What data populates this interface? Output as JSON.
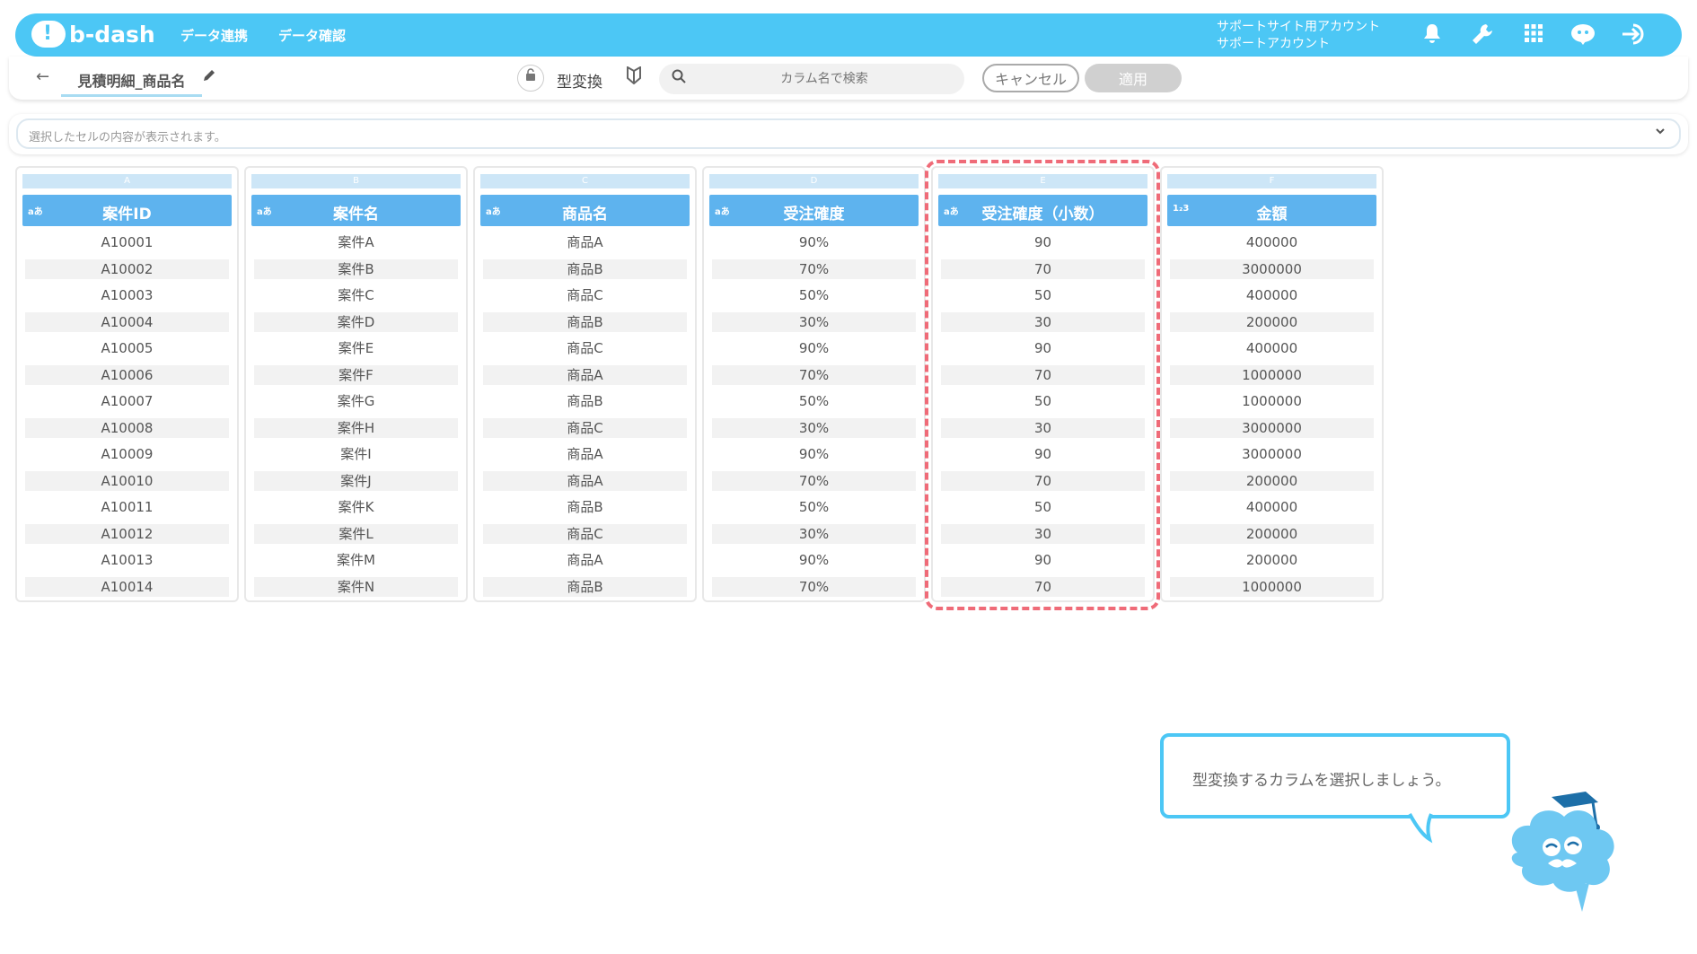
{
  "header": {
    "logo_text": "b-dash",
    "nav": [
      "データ連携",
      "データ確認"
    ],
    "account_line1": "サポートサイト用アカウント",
    "account_line2": "サポートアカウント",
    "icons": [
      "bell-icon",
      "wrench-icon",
      "grid-icon",
      "chat-mascot-icon",
      "logout-icon"
    ]
  },
  "toolbar": {
    "back": "←",
    "title": "見積明細_商品名",
    "mode_label": "型変換",
    "search_placeholder": "カラム名で検索",
    "cancel_label": "キャンセル",
    "apply_label": "適用"
  },
  "cellbar": {
    "placeholder": "選択したセルの内容が表示されます。"
  },
  "columns": [
    {
      "letter": "A",
      "type": "aあ",
      "name": "案件ID",
      "values": [
        "A10001",
        "A10002",
        "A10003",
        "A10004",
        "A10005",
        "A10006",
        "A10007",
        "A10008",
        "A10009",
        "A10010",
        "A10011",
        "A10012",
        "A10013",
        "A10014"
      ]
    },
    {
      "letter": "B",
      "type": "aあ",
      "name": "案件名",
      "values": [
        "案件A",
        "案件B",
        "案件C",
        "案件D",
        "案件E",
        "案件F",
        "案件G",
        "案件H",
        "案件I",
        "案件J",
        "案件K",
        "案件L",
        "案件M",
        "案件N"
      ]
    },
    {
      "letter": "C",
      "type": "aあ",
      "name": "商品名",
      "values": [
        "商品A",
        "商品B",
        "商品C",
        "商品B",
        "商品C",
        "商品A",
        "商品B",
        "商品C",
        "商品A",
        "商品A",
        "商品B",
        "商品C",
        "商品A",
        "商品B"
      ]
    },
    {
      "letter": "D",
      "type": "aあ",
      "name": "受注確度",
      "values": [
        "90%",
        "70%",
        "50%",
        "30%",
        "90%",
        "70%",
        "50%",
        "30%",
        "90%",
        "70%",
        "50%",
        "30%",
        "90%",
        "70%"
      ]
    },
    {
      "letter": "E",
      "type": "aあ",
      "name": "受注確度（小数）",
      "values": [
        "90",
        "70",
        "50",
        "30",
        "90",
        "70",
        "50",
        "30",
        "90",
        "70",
        "50",
        "30",
        "90",
        "70"
      ]
    },
    {
      "letter": "F",
      "type": "1₂3",
      "name": "金額",
      "values": [
        "400000",
        "3000000",
        "400000",
        "200000",
        "400000",
        "1000000",
        "1000000",
        "3000000",
        "3000000",
        "200000",
        "400000",
        "200000",
        "200000",
        "1000000"
      ]
    }
  ],
  "guide": {
    "message": "型変換するカラムを選択しましょう。"
  }
}
